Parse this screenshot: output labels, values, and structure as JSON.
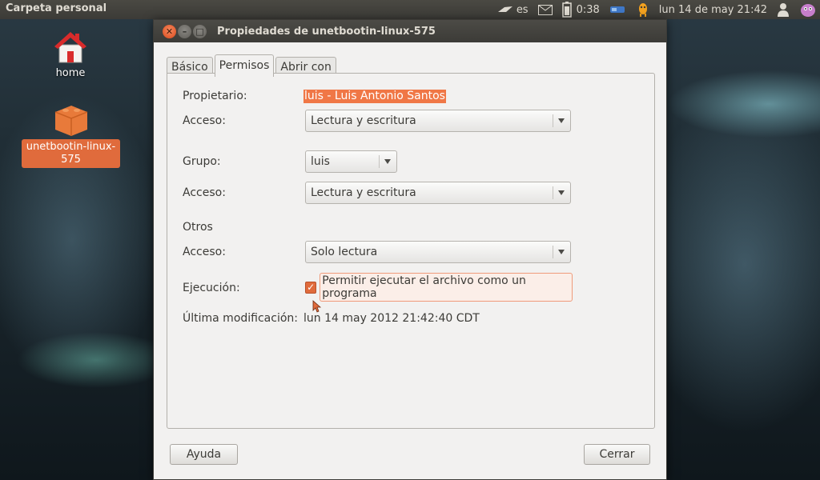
{
  "top_panel": {
    "app_title": "Carpeta personal",
    "keyboard_layout": "es",
    "battery_time": "0:38",
    "datetime": "lun 14 de may 21:42"
  },
  "desktop": {
    "icons": [
      {
        "label": "home"
      },
      {
        "label": "unetbootin-linux-575"
      }
    ]
  },
  "dialog": {
    "title": "Propiedades de unetbootin-linux-575",
    "tabs": [
      {
        "label": "Básico",
        "active": false
      },
      {
        "label": "Permisos",
        "active": true
      },
      {
        "label": "Abrir con",
        "active": false
      }
    ],
    "owner": {
      "label": "Propietario:",
      "value": "luis - Luis Antonio Santos"
    },
    "owner_access": {
      "label": "Acceso:",
      "value": "Lectura y escritura"
    },
    "group": {
      "label": "Grupo:",
      "value": "luis"
    },
    "group_access": {
      "label": "Acceso:",
      "value": "Lectura y escritura"
    },
    "others": {
      "heading": "Otros",
      "access_label": "Acceso:",
      "access_value": "Solo lectura"
    },
    "execution": {
      "label": "Ejecución:",
      "checkbox_label": "Permitir ejecutar el archivo como un programa",
      "checked": true
    },
    "last_modified": {
      "label": "Última modificación:",
      "value": "lun 14 may 2012 21:42:40 CDT"
    },
    "buttons": {
      "help": "Ayuda",
      "close": "Cerrar"
    }
  },
  "colors": {
    "accent": "#e06b3c",
    "panel": "#3c3b37",
    "dialog_bg": "#f2f1f0"
  }
}
